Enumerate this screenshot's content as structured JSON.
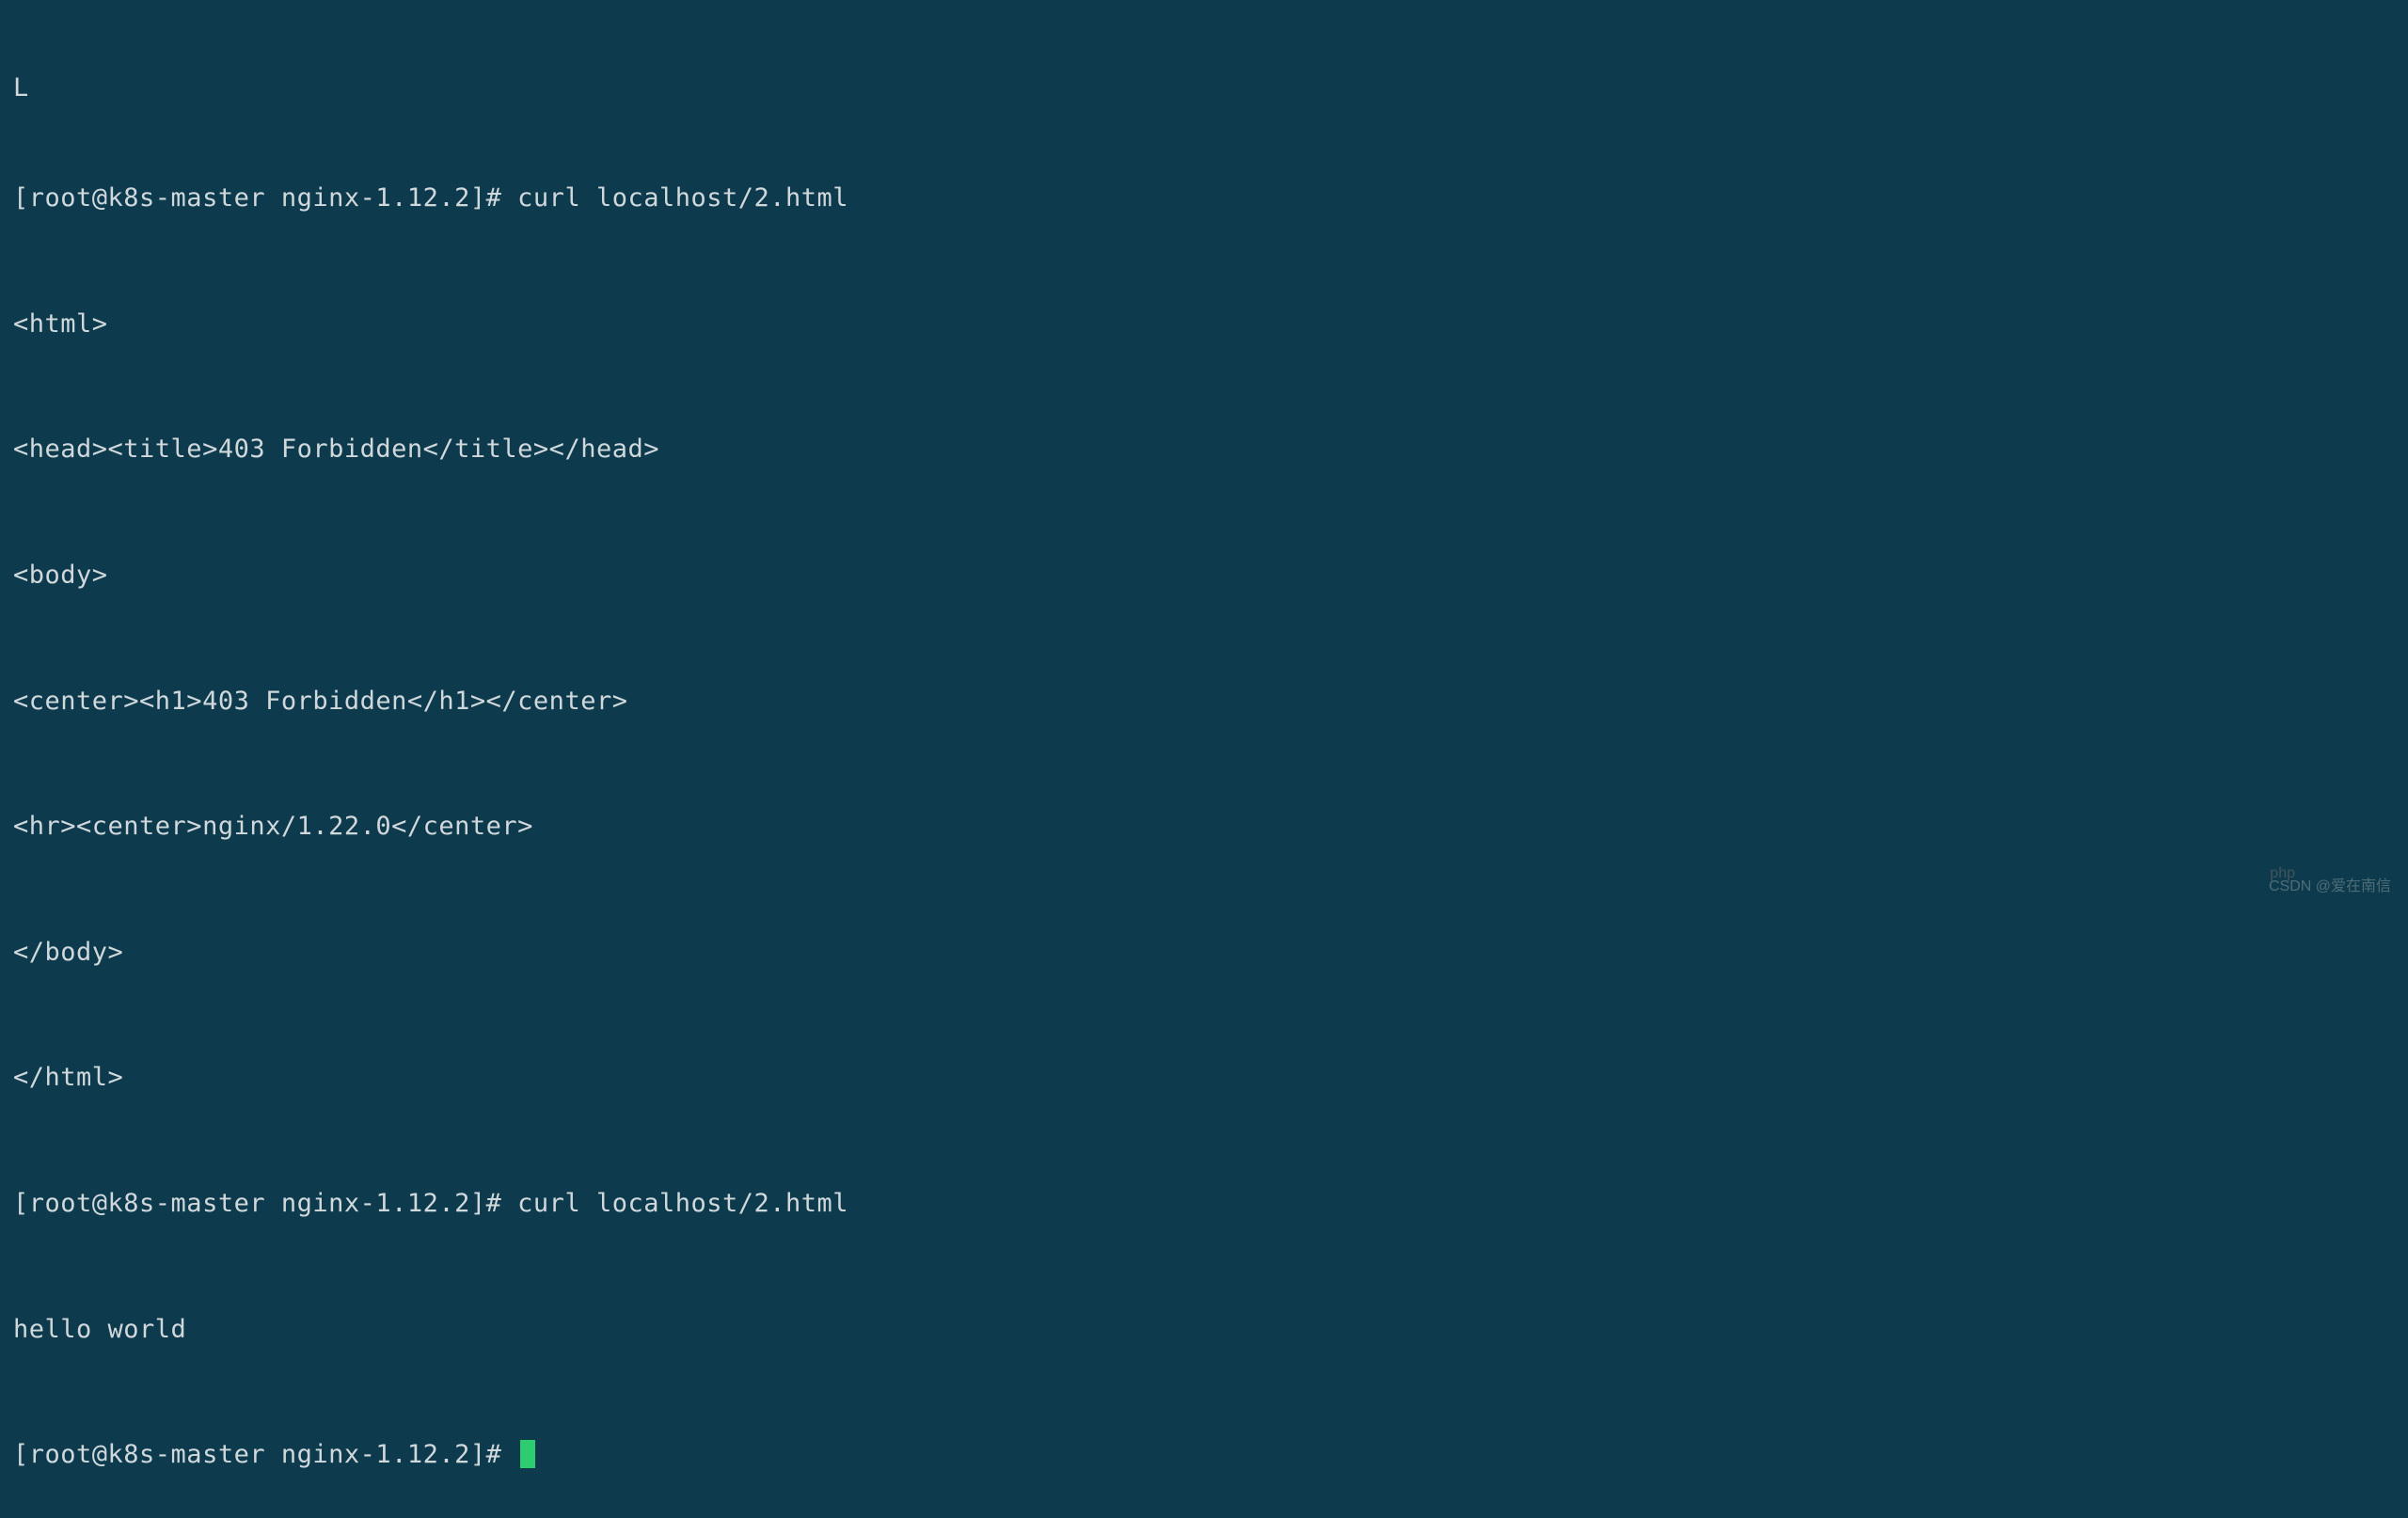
{
  "terminal": {
    "top_fragment": "L",
    "lines": [
      {
        "type": "prompt",
        "prompt": "[root@k8s-master nginx-1.12.2]# ",
        "command": "curl localhost/2.html"
      },
      {
        "type": "output",
        "text": "<html>"
      },
      {
        "type": "output",
        "text": "<head><title>403 Forbidden</title></head>"
      },
      {
        "type": "output",
        "text": "<body>"
      },
      {
        "type": "output",
        "text": "<center><h1>403 Forbidden</h1></center>"
      },
      {
        "type": "output",
        "text": "<hr><center>nginx/1.22.0</center>"
      },
      {
        "type": "output",
        "text": "</body>"
      },
      {
        "type": "output",
        "text": "</html>"
      },
      {
        "type": "prompt",
        "prompt": "[root@k8s-master nginx-1.12.2]# ",
        "command": "curl localhost/2.html"
      },
      {
        "type": "output",
        "text": "hello world"
      },
      {
        "type": "prompt_cursor",
        "prompt": "[root@k8s-master nginx-1.12.2]# "
      }
    ]
  },
  "watermark": {
    "icon": "php",
    "text": "CSDN @爱在南信"
  },
  "colors": {
    "background": "#0d3b4d",
    "text": "#d0d8dc",
    "cursor": "#2ecc71"
  }
}
